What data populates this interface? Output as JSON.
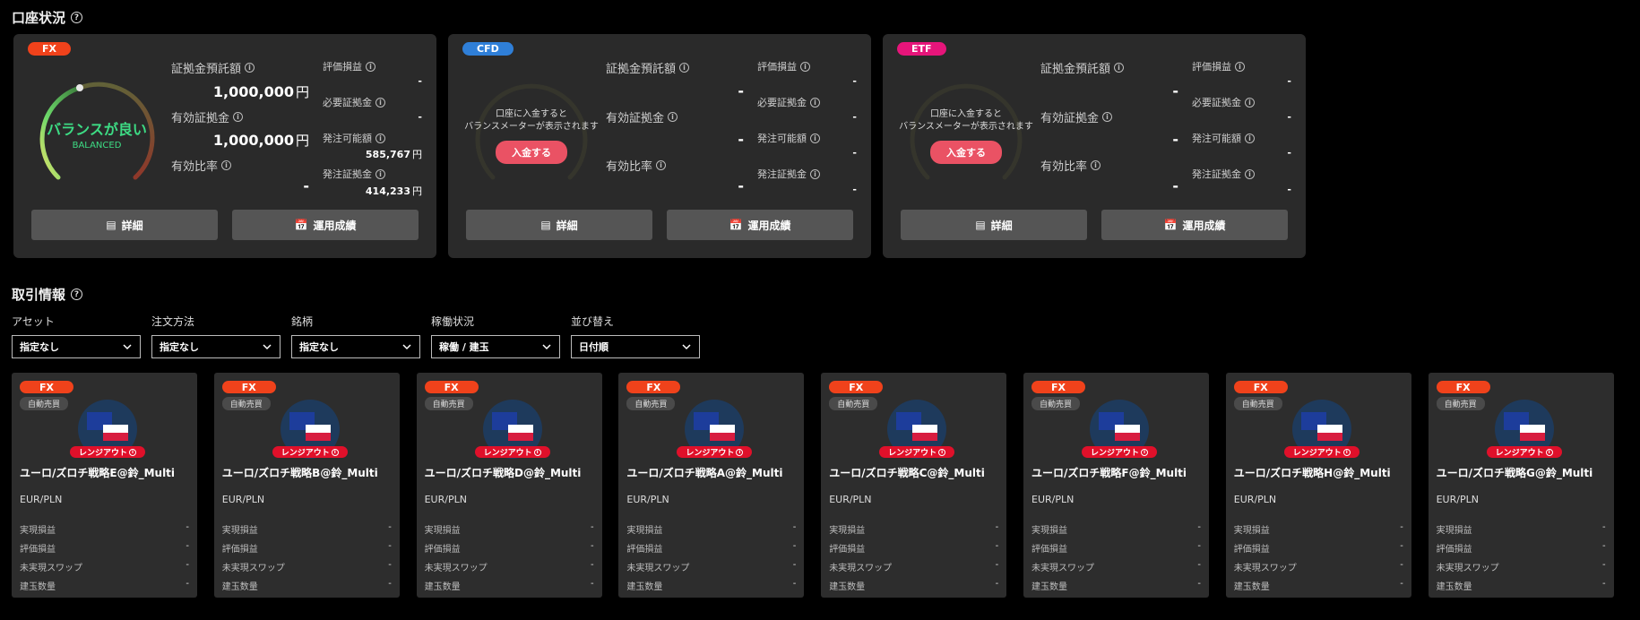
{
  "account_section": {
    "title": "口座状況"
  },
  "fx_account": {
    "badge": "FX",
    "balance_main": "バランスが良い",
    "balance_sub": "BALANCED",
    "deposit_label": "証拠金預託額",
    "deposit_value": "1,000,000",
    "effective_label": "有効証拠金",
    "effective_value": "1,000,000",
    "ratio_label": "有効比率",
    "ratio_value": "-",
    "unit": "円",
    "eval_label": "評価損益",
    "eval_value": "-",
    "required_label": "必要証拠金",
    "required_value": "-",
    "orderable_label": "発注可能額",
    "orderable_value": "585,767",
    "order_margin_label": "発注証拠金",
    "order_margin_value": "414,233",
    "detail_btn": "詳細",
    "perf_btn": "運用成績"
  },
  "cfd_account": {
    "badge": "CFD",
    "gauge_msg1": "口座に入金すると",
    "gauge_msg2": "バランスメーターが表示されます",
    "deposit_btn": "入金する",
    "deposit_label": "証拠金預託額",
    "deposit_value": "-",
    "effective_label": "有効証拠金",
    "effective_value": "-",
    "ratio_label": "有効比率",
    "ratio_value": "-",
    "eval_label": "評価損益",
    "eval_value": "-",
    "required_label": "必要証拠金",
    "required_value": "-",
    "orderable_label": "発注可能額",
    "orderable_value": "-",
    "order_margin_label": "発注証拠金",
    "order_margin_value": "-",
    "detail_btn": "詳細",
    "perf_btn": "運用成績"
  },
  "etf_account": {
    "badge": "ETF",
    "gauge_msg1": "口座に入金すると",
    "gauge_msg2": "バランスメーターが表示されます",
    "deposit_btn": "入金する",
    "deposit_label": "証拠金預託額",
    "deposit_value": "-",
    "effective_label": "有効証拠金",
    "effective_value": "-",
    "ratio_label": "有効比率",
    "ratio_value": "-",
    "eval_label": "評価損益",
    "eval_value": "-",
    "required_label": "必要証拠金",
    "required_value": "-",
    "orderable_label": "発注可能額",
    "orderable_value": "-",
    "order_margin_label": "発注証拠金",
    "order_margin_value": "-",
    "detail_btn": "詳細",
    "perf_btn": "運用成績"
  },
  "trade_section": {
    "title": "取引情報"
  },
  "filters": [
    {
      "label": "アセット",
      "value": "指定なし"
    },
    {
      "label": "注文方法",
      "value": "指定なし"
    },
    {
      "label": "銘柄",
      "value": "指定なし"
    },
    {
      "label": "稼働状況",
      "value": "稼働 / 建玉"
    },
    {
      "label": "並び替え",
      "value": "日付順"
    }
  ],
  "trade_common": {
    "badge": "FX",
    "auto": "自動売買",
    "rangeout": "レンジアウト",
    "pair": "EUR/PLN",
    "realized_label": "実現損益",
    "eval_label": "評価損益",
    "swap_label": "未実現スワップ",
    "qty_label": "建玉数量",
    "dash": "-"
  },
  "trade_cards": [
    {
      "name": "ユーロ/ズロチ戦略E@鈴_Multi"
    },
    {
      "name": "ユーロ/ズロチ戦略B@鈴_Multi"
    },
    {
      "name": "ユーロ/ズロチ戦略D@鈴_Multi"
    },
    {
      "name": "ユーロ/ズロチ戦略A@鈴_Multi"
    },
    {
      "name": "ユーロ/ズロチ戦略C@鈴_Multi"
    },
    {
      "name": "ユーロ/ズロチ戦略F@鈴_Multi"
    },
    {
      "name": "ユーロ/ズロチ戦略H@鈴_Multi"
    },
    {
      "name": "ユーロ/ズロチ戦略G@鈴_Multi"
    }
  ],
  "colors": {
    "fx_badge": "#f0421b",
    "cfd_badge": "#2f7fd8",
    "etf_badge": "#e6157a",
    "balanced": "#3ddc84",
    "deposit_btn": "#ea5264"
  }
}
